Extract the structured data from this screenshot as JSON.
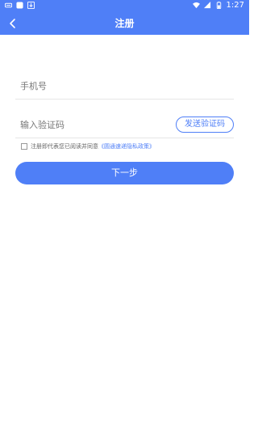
{
  "status_bar": {
    "time": "1:27",
    "colors": {
      "background": "#4f7ff7",
      "foreground": "#ffffff"
    }
  },
  "app_bar": {
    "title": "注册",
    "back_icon": "chevron-left-icon"
  },
  "form": {
    "phone": {
      "placeholder": "手机号",
      "value": ""
    },
    "code": {
      "placeholder": "输入验证码",
      "value": ""
    },
    "send_code_label": "发送验证码",
    "agreement": {
      "text": "注册即代表您已阅读并同意",
      "link": "《圆通速递隐私政策》",
      "checked": false
    },
    "next_label": "下一步"
  },
  "colors": {
    "accent": "#4f7ff7",
    "background": "#ffffff"
  }
}
